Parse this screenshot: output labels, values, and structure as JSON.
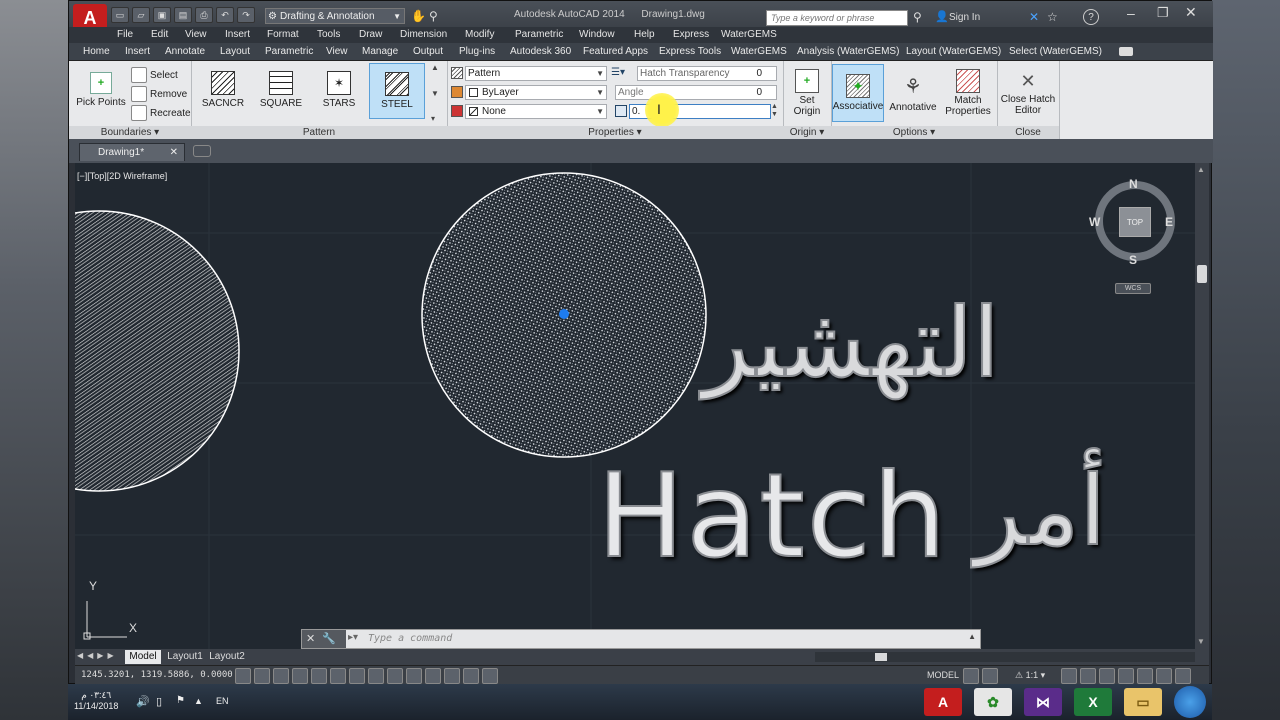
{
  "window": {
    "title": "Autodesk AutoCAD 2014",
    "doc_title": "Drawing1.dwg",
    "workspace": "Drafting & Annotation",
    "search_placeholder": "Type a keyword or phrase",
    "sign_in": "Sign In",
    "help": "?"
  },
  "menu": [
    "File",
    "Edit",
    "View",
    "Insert",
    "Format",
    "Tools",
    "Draw",
    "Dimension",
    "Modify",
    "Parametric",
    "Window",
    "Help",
    "Express",
    "WaterGEMS"
  ],
  "ribbon_tabs": [
    "Home",
    "Insert",
    "Annotate",
    "Layout",
    "Parametric",
    "View",
    "Manage",
    "Output",
    "Plug-ins",
    "Autodesk 360",
    "Featured Apps",
    "Express Tools",
    "WaterGEMS",
    "Analysis (WaterGEMS)",
    "Layout (WaterGEMS)",
    "Select (WaterGEMS)"
  ],
  "ribbon": {
    "boundaries": {
      "title": "Boundaries",
      "pick_points": "Pick Points",
      "select": "Select",
      "remove": "Remove",
      "recreate": "Recreate"
    },
    "pattern": {
      "title": "Pattern",
      "swatches": [
        "SACNCR",
        "SQUARE",
        "STARS",
        "STEEL"
      ],
      "selected": "STEEL"
    },
    "properties": {
      "title": "Properties",
      "pattern_type": "Pattern",
      "color": "ByLayer",
      "background": "None",
      "transparency_label": "Hatch Transparency",
      "transparency_value": "0",
      "angle_label": "Angle",
      "angle_value": "0",
      "scale_value": "0."
    },
    "origin": {
      "title": "Origin",
      "set_origin": "Set Origin"
    },
    "options": {
      "title": "Options",
      "associative": "Associative",
      "annotative": "Annotative",
      "match_properties": "Match Properties"
    },
    "close": {
      "title": "Close",
      "close_editor": "Close Hatch Editor"
    }
  },
  "doc_tab": "Drawing1*",
  "viewport_label": "[−][Top][2D Wireframe]",
  "viewcube": {
    "north": "N",
    "south": "S",
    "east": "E",
    "west": "W",
    "top": "TOP",
    "wcs": "WCS"
  },
  "overlay": {
    "arabic_title": "التهشير",
    "english": "Hatch",
    "arabic_cmd": "أمر"
  },
  "ucs": {
    "x": "X",
    "y": "Y"
  },
  "command_placeholder": "Type a command",
  "layout_tabs": [
    "Model",
    "Layout1",
    "Layout2"
  ],
  "status": {
    "coords": "1245.3201, 1319.5886, 0.0000",
    "model": "MODEL",
    "scale": "1:1"
  },
  "taskbar": {
    "time": "٠٣:٤٦ م",
    "date": "11/14/2018",
    "lang": "EN"
  }
}
